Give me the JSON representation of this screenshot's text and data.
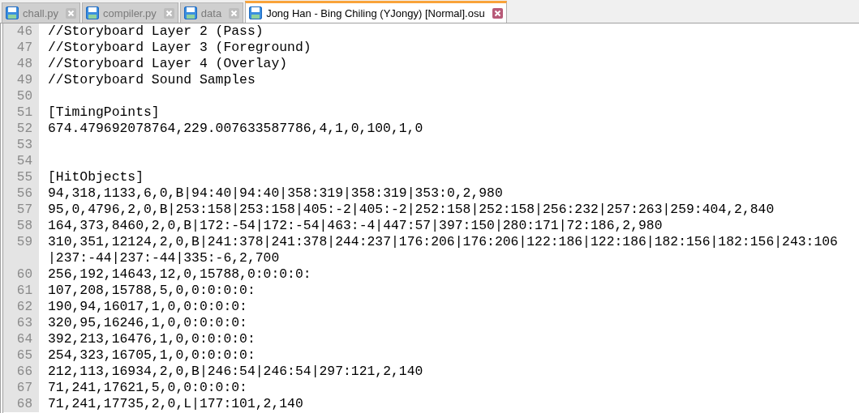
{
  "tabs": [
    {
      "label": "chall.py",
      "selected": false
    },
    {
      "label": "compiler.py",
      "selected": false
    },
    {
      "label": "data",
      "selected": false
    },
    {
      "label": "Jong Han - Bing Chiling (YJongy) [Normal].osu",
      "selected": true
    }
  ],
  "lines": [
    {
      "number": "46",
      "text": "//Storyboard Layer 2 (Pass)"
    },
    {
      "number": "47",
      "text": "//Storyboard Layer 3 (Foreground)"
    },
    {
      "number": "48",
      "text": "//Storyboard Layer 4 (Overlay)"
    },
    {
      "number": "49",
      "text": "//Storyboard Sound Samples"
    },
    {
      "number": "50"
    },
    {
      "number": "51",
      "text": "[TimingPoints]"
    },
    {
      "number": "52",
      "text": "674.479692078764,229.007633587786,4,1,0,100,1,0"
    },
    {
      "number": "53"
    },
    {
      "number": "54"
    },
    {
      "number": "55",
      "text": "[HitObjects]"
    },
    {
      "number": "56",
      "text": "94,318,1133,6,0,B|94:40|94:40|358:319|358:319|353:0,2,980"
    },
    {
      "number": "57",
      "text": "95,0,4796,2,0,B|253:158|253:158|405:-2|405:-2|252:158|252:158|256:232|257:263|259:404,2,840"
    },
    {
      "number": "58",
      "text": "164,373,8460,2,0,B|172:-54|172:-54|463:-4|447:57|397:150|280:171|72:186,2,980"
    },
    {
      "number": "59",
      "text": "310,351,12124,2,0,B|241:378|241:378|244:237|176:206|176:206|122:186|122:186|182:156|182:156|243:106|237:-44|237:-44|335:-6,2,700"
    },
    {
      "number": "60",
      "text": "256,192,14643,12,0,15788,0:0:0:0:"
    },
    {
      "number": "61",
      "text": "107,208,15788,5,0,0:0:0:0:"
    },
    {
      "number": "62",
      "text": "190,94,16017,1,0,0:0:0:0:"
    },
    {
      "number": "63",
      "text": "320,95,16246,1,0,0:0:0:0:"
    },
    {
      "number": "64",
      "text": "392,213,16476,1,0,0:0:0:0:"
    },
    {
      "number": "65",
      "text": "254,323,16705,1,0,0:0:0:0:"
    },
    {
      "number": "66",
      "text": "212,113,16934,2,0,B|246:54|246:54|297:121,2,140"
    },
    {
      "number": "67",
      "text": "71,241,17621,5,0,0:0:0:0:"
    },
    {
      "number": "68",
      "text": "71,241,17735,2,0,L|177:101,2,140"
    }
  ]
}
